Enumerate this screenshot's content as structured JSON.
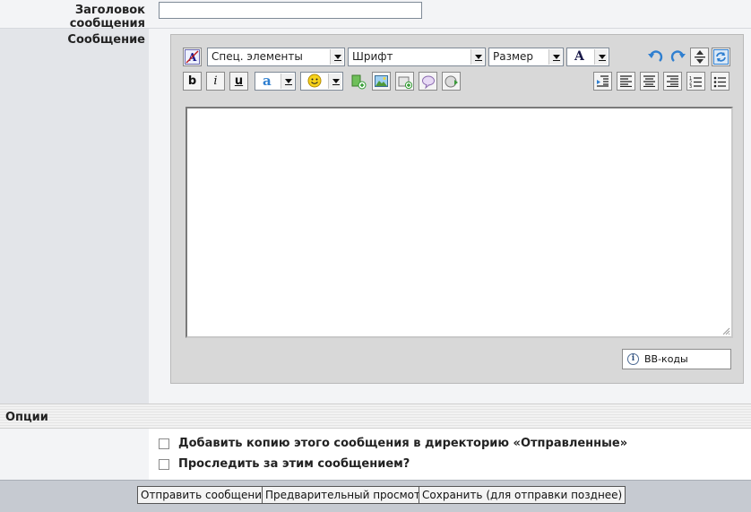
{
  "form": {
    "subject_label": "Заголовок сообщения",
    "subject_value": "",
    "message_label": "Сообщение"
  },
  "toolbar": {
    "special_elements": "Спец. элементы",
    "font": "Шрифт",
    "size": "Размер",
    "font_color_glyph": "A",
    "bold_glyph": "b",
    "italic_glyph": "i",
    "underline_glyph": "u",
    "text_color_glyph": "a"
  },
  "editor": {
    "message_value": "",
    "bbcodes_label": "BB-коды"
  },
  "options": {
    "header": "Опции",
    "items": [
      {
        "label": "Добавить копию этого сообщения в директорию «Отправленные»",
        "checked": false
      },
      {
        "label": "Проследить за этим сообщением?",
        "checked": false
      }
    ]
  },
  "footer": {
    "send": "Отправить сообщение",
    "preview": "Предварительный просмотр",
    "save": "Сохранить (для отправки позднее)"
  },
  "colors": {
    "accent_icon_blue": "#2f7fd0",
    "editor_panel_bg": "#d8d8d8",
    "footer_bg": "#c6cad1"
  }
}
